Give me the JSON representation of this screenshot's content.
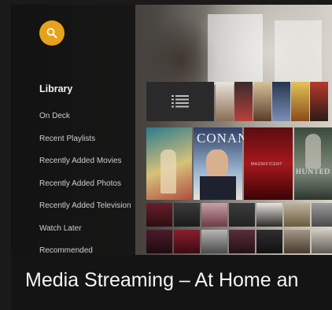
{
  "sidebar": {
    "search_icon": "search-icon",
    "search_color": "#e7a21b",
    "title": "Library",
    "items": [
      {
        "label": "On Deck"
      },
      {
        "label": "Recent Playlists"
      },
      {
        "label": "Recently Added Movies"
      },
      {
        "label": "Recently Added Photos"
      },
      {
        "label": "Recently Added Television"
      },
      {
        "label": "Watch Later"
      },
      {
        "label": "Recommended"
      }
    ]
  },
  "posters": {
    "conan_title": "CONAN",
    "p3_text": "MAGNIFICENT",
    "p4_text": "HUNTED"
  },
  "caption": {
    "text": "Media Streaming – At Home an"
  }
}
